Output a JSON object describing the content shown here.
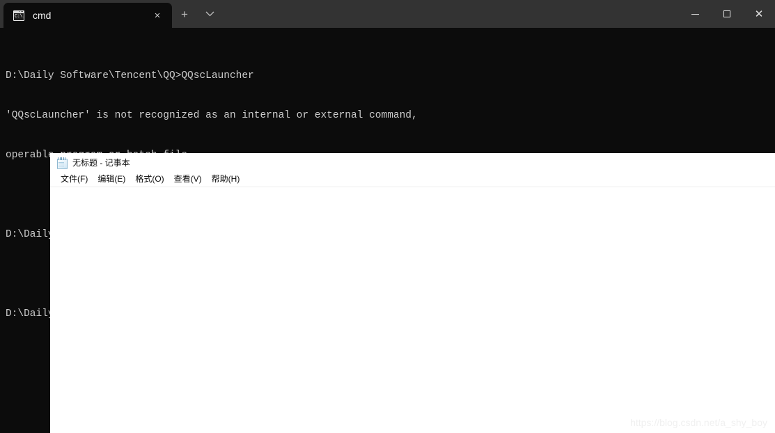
{
  "terminal": {
    "tabs": [
      {
        "title": "cmd",
        "icon": "console-icon",
        "active": true,
        "close_label": "×"
      }
    ],
    "new_tab_label": "+",
    "tab_dropdown_label": "⌄",
    "window_controls": {
      "minimize_label": "—",
      "maximize_label": "□",
      "close_label": "✕"
    },
    "prompt_glyph": "C:\\.",
    "console_lines": [
      "D:\\Daily Software\\Tencent\\QQ>QQscLauncher",
      "'QQscLauncher' is not recognized as an internal or external command,",
      "operable program or batch file.",
      "",
      "D:\\Daily Software\\Tencent\\QQ>notepad",
      "",
      "D:\\Daily Software\\Tencent\\QQ>"
    ],
    "colors": {
      "titlebar_background": "#333333",
      "console_background": "#0c0c0c",
      "console_text": "#cccccc",
      "tab_active_background": "#0c0c0c"
    }
  },
  "notepad": {
    "title": "无标题 - 记事本",
    "icon": "notepad-icon",
    "menu": [
      {
        "label": "文件(F)"
      },
      {
        "label": "编辑(E)"
      },
      {
        "label": "格式(O)"
      },
      {
        "label": "查看(V)"
      },
      {
        "label": "帮助(H)"
      }
    ],
    "document_text": "",
    "colors": {
      "background": "#ffffff",
      "text": "#111111",
      "separator": "#ededed"
    }
  },
  "watermark": {
    "text": "https://blog.csdn.net/a_shy_boy",
    "color": "#f0f0f0"
  }
}
